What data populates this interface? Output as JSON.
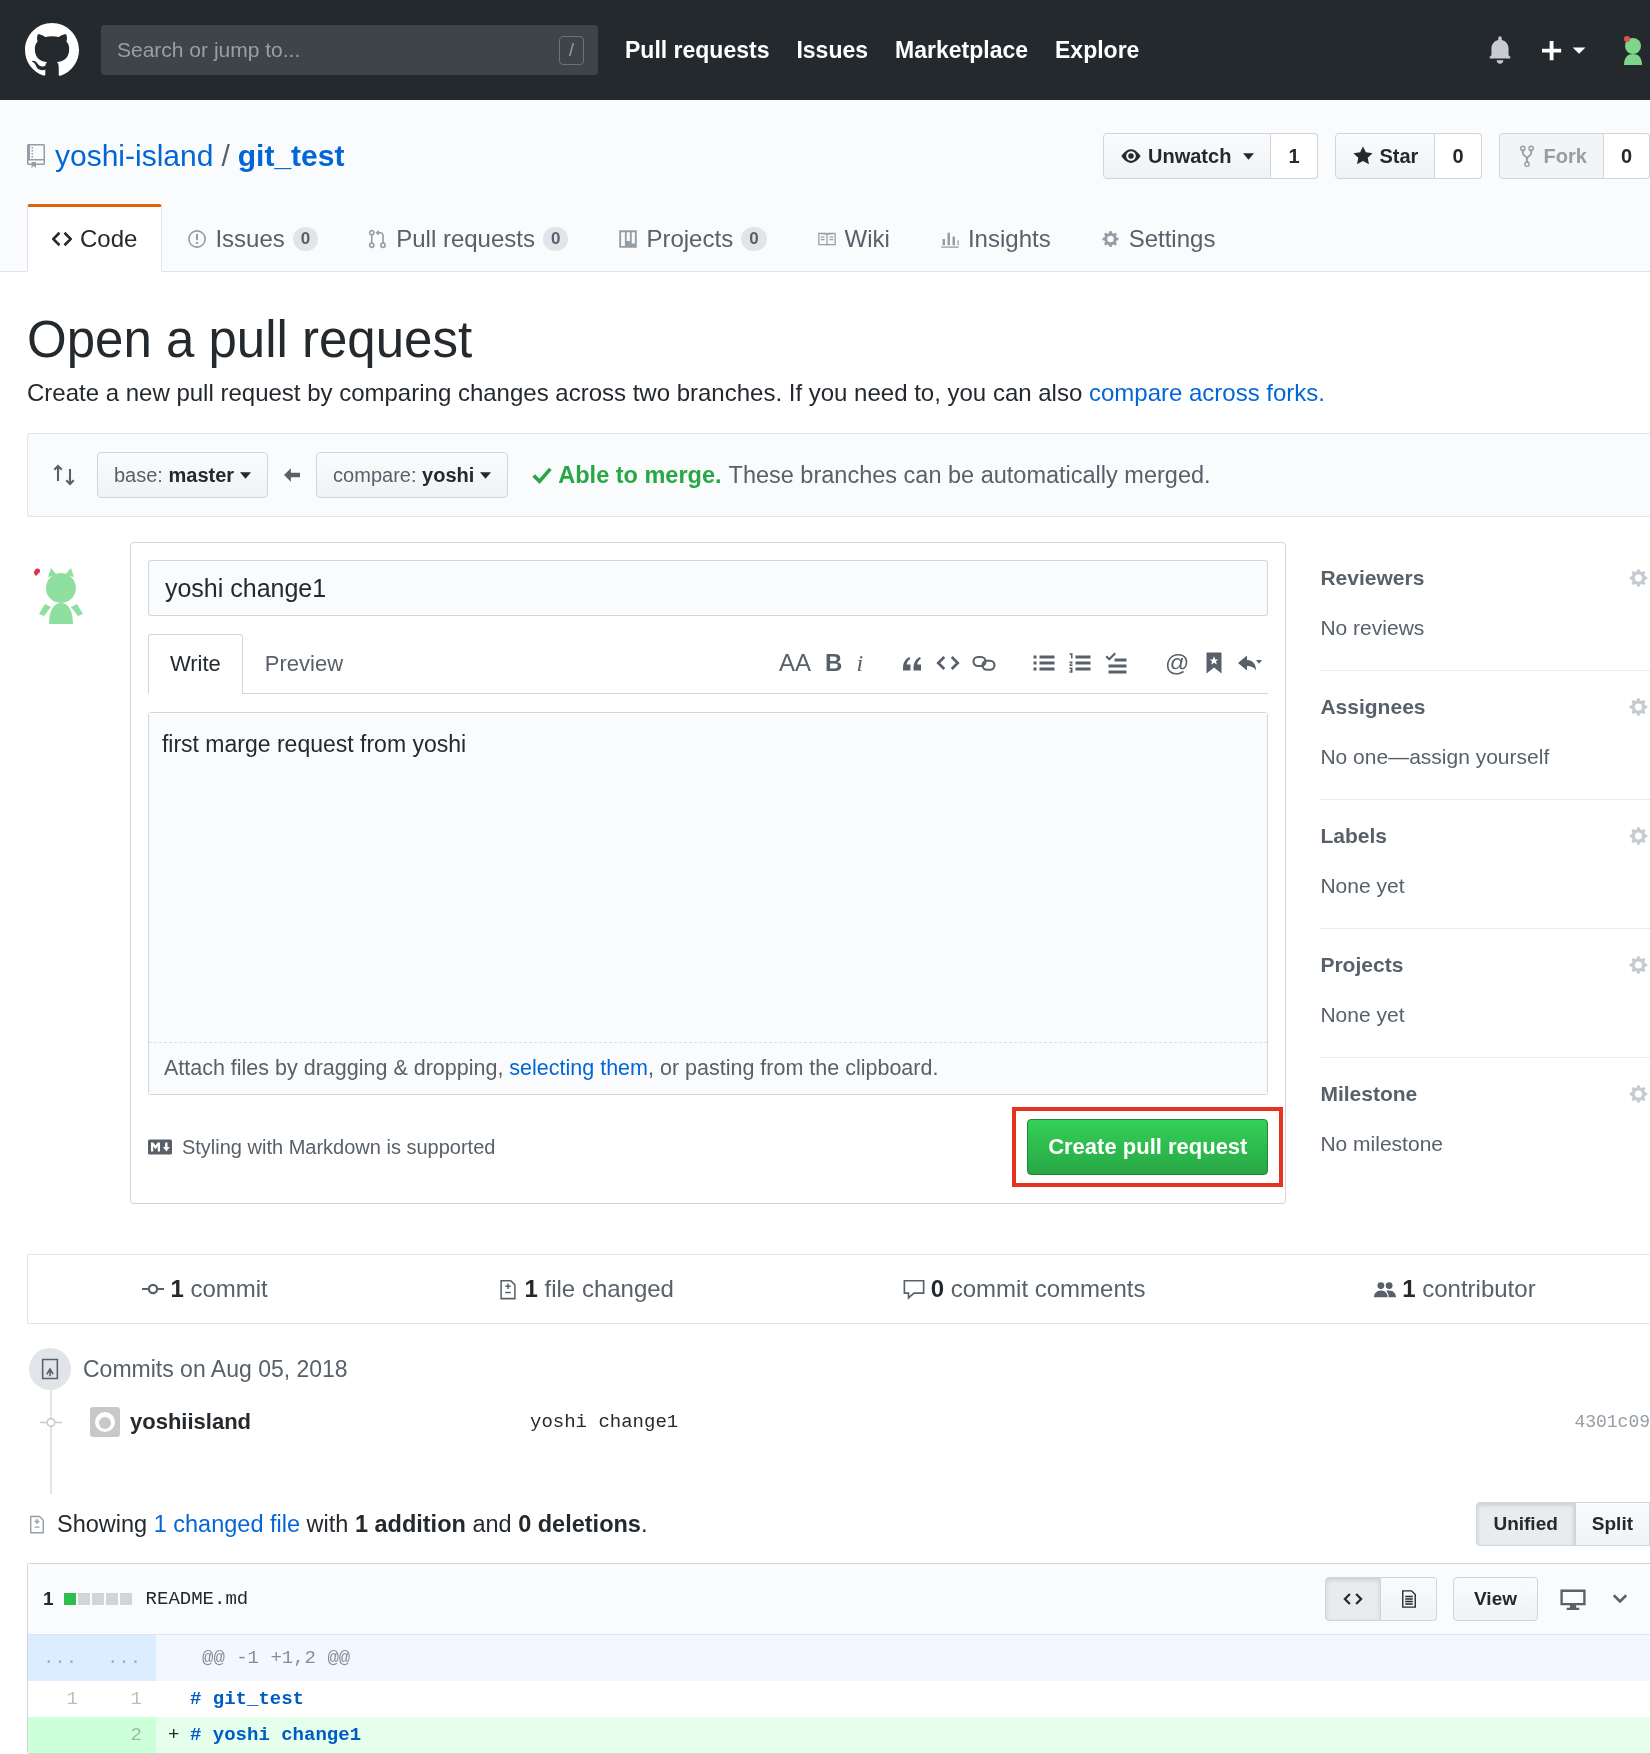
{
  "header": {
    "search": {
      "placeholder": "Search or jump to...",
      "key": "/"
    },
    "nav": [
      "Pull requests",
      "Issues",
      "Marketplace",
      "Explore"
    ]
  },
  "repo": {
    "owner": "yoshi-island",
    "separator": "/",
    "name": "git_test",
    "actions": [
      {
        "label": "Unwatch",
        "count": "1",
        "caret": true,
        "disabled": false
      },
      {
        "label": "Star",
        "count": "0",
        "caret": false,
        "disabled": false
      },
      {
        "label": "Fork",
        "count": "0",
        "caret": false,
        "disabled": true
      }
    ]
  },
  "tabs": [
    {
      "label": "Code",
      "selected": true
    },
    {
      "label": "Issues",
      "counter": "0",
      "selected": false
    },
    {
      "label": "Pull requests",
      "counter": "0",
      "selected": false
    },
    {
      "label": "Projects",
      "counter": "0",
      "selected": false
    },
    {
      "label": "Wiki",
      "selected": false
    },
    {
      "label": "Insights",
      "selected": false
    },
    {
      "label": "Settings",
      "selected": false
    }
  ],
  "heading": "Open a pull request",
  "description": {
    "text": "Create a new pull request by comparing changes across two branches. If you need to, you can also",
    "link": "compare across forks."
  },
  "range": {
    "base": {
      "prefix": "base:",
      "value": "master"
    },
    "compare": {
      "prefix": "compare:",
      "value": "yoshi"
    },
    "merge": {
      "title": "Able to merge.",
      "text": "These branches can be automatically merged."
    }
  },
  "form": {
    "title_value": "yoshi change1",
    "tabs": [
      {
        "label": "Write",
        "selected": true
      },
      {
        "label": "Preview",
        "selected": false
      }
    ],
    "toolbar_glyphs": [
      "AA",
      "B",
      "i",
      "@"
    ],
    "body": "first marge request from yoshi",
    "attach": {
      "before": "Attach files by dragging & dropping,",
      "link": "selecting them",
      "after": ", or pasting from the clipboard."
    },
    "markdown_note": "Styling with Markdown is supported",
    "submit": "Create pull request",
    "submit_highlighted": true
  },
  "sidebar": [
    {
      "title": "Reviewers",
      "value": "No reviews"
    },
    {
      "title": "Assignees",
      "value": "No one—assign yourself"
    },
    {
      "title": "Labels",
      "value": "None yet"
    },
    {
      "title": "Projects",
      "value": "None yet"
    },
    {
      "title": "Milestone",
      "value": "No milestone"
    }
  ],
  "stats": [
    {
      "count": "1",
      "label": "commit"
    },
    {
      "count": "1",
      "label": "file changed"
    },
    {
      "count": "0",
      "label": "commit comments"
    },
    {
      "count": "1",
      "label": "contributor"
    }
  ],
  "commits": {
    "date": "Commits on Aug 05, 2018",
    "rows": [
      {
        "author": "yoshiisland",
        "message": "yoshi change1",
        "sha": "4301c09"
      }
    ]
  },
  "summary": {
    "before": "Showing",
    "link": "1 changed file",
    "after": "with **1 addition** and **0 deletions**."
  },
  "views": [
    {
      "label": "Unified",
      "selected": true
    },
    {
      "label": "Split",
      "selected": false
    }
  ],
  "file": {
    "count": "1",
    "name": "README.md",
    "view": "View",
    "lines": [
      {
        "kind": "hunk",
        "old": "...",
        "new": "...",
        "text": "@@ -1 +1,2 @@"
      },
      {
        "kind": "context",
        "old": "1",
        "new": "1",
        "text": "# git_test"
      },
      {
        "kind": "addition",
        "new": "2",
        "marker": "+",
        "text": "# yoshi change1"
      }
    ]
  }
}
